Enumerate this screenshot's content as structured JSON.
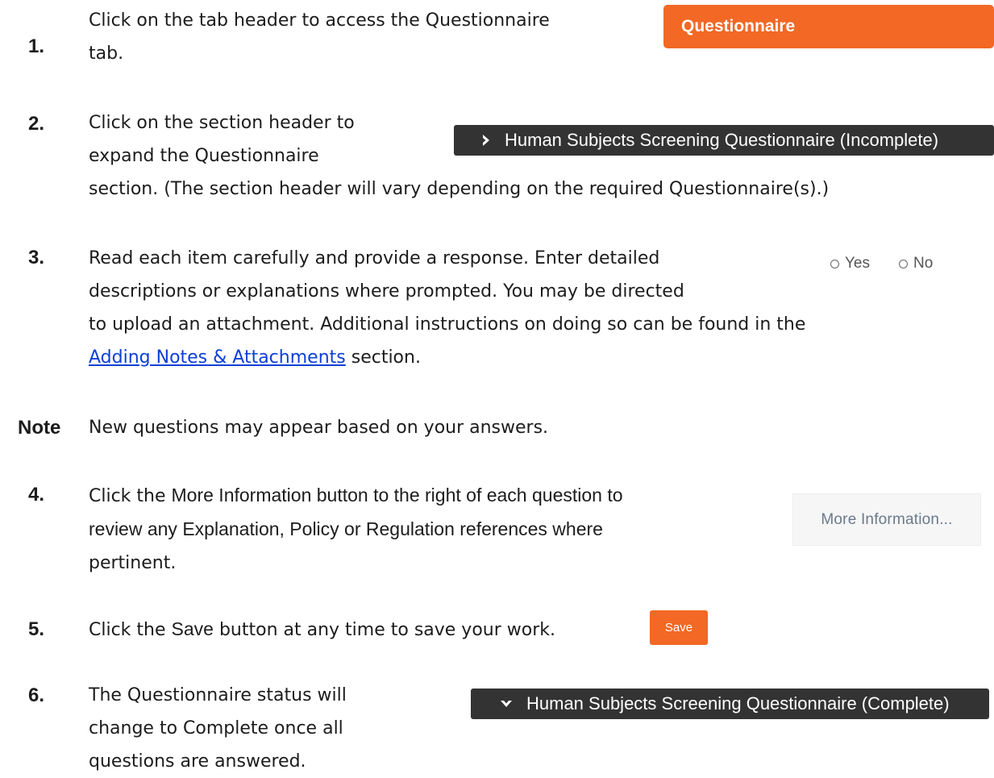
{
  "steps": [
    {
      "number": "1.",
      "lines": [
        "Click on the tab header to access the Questionnaire",
        "tab."
      ]
    },
    {
      "number": "2.",
      "lines": [
        "Click on the section header to",
        "expand the Questionnaire",
        "section. (The section header will vary depending on the required Questionnaire(s).)"
      ]
    },
    {
      "number": "3.",
      "lines": [
        "Read each item carefully and provide a response. Enter detailed",
        "descriptions or explanations where prompted. You may be directed",
        "to upload an attachment. Additional instructions on doing so can be found in the"
      ],
      "link_text": "Adding Notes & Attachments",
      "after_link": " section."
    },
    {
      "number": "Note",
      "lines": [
        "New questions may appear based on your answers."
      ]
    },
    {
      "number": "4.",
      "line1_pre": "Click the ",
      "line1_mixed": "More Information button to the right of each question to",
      "line2_mixed": "review any Explanation, Policy or Regulation references where",
      "line3": "pertinent."
    },
    {
      "number": "5.",
      "pre": "Click the ",
      "mixed": "Save",
      "post": " button at any time to save your work."
    },
    {
      "number": "6.",
      "lines": [
        "The Questionnaire status will",
        "change to Complete once all",
        "questions are answered."
      ]
    }
  ],
  "ui": {
    "tab_label": "Questionnaire",
    "section_incomplete": "Human Subjects Screening Questionnaire (Incomplete)",
    "section_complete": "Human Subjects Screening Questionnaire (Complete)",
    "radio_yes": "Yes",
    "radio_no": "No",
    "more_info_label": "More Information...",
    "save_label": "Save"
  },
  "colors": {
    "accent_orange": "#f26824",
    "section_dark": "#333333",
    "link_blue": "#0b3fd6"
  }
}
